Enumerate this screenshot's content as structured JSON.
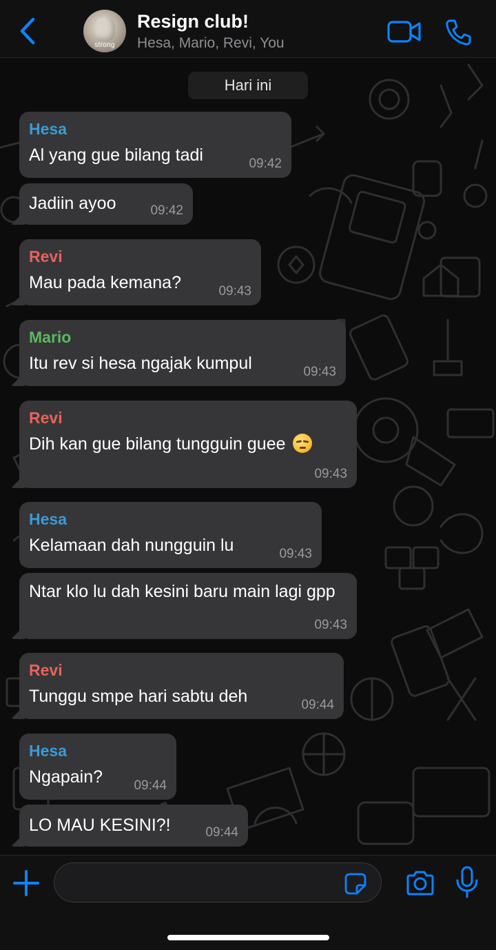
{
  "header": {
    "title": "Resign club!",
    "members": "Hesa, Mario, Revi, You",
    "avatar_caption": "strong"
  },
  "date_chip": "Hari ini",
  "messages": [
    {
      "sender": "Hesa",
      "sender_color": "#3a9bd9",
      "text": "Al yang gue bilang tadi",
      "time": "09:42"
    },
    {
      "sender": "",
      "text": "Jadiin ayoo",
      "time": "09:42"
    },
    {
      "sender": "Revi",
      "sender_color": "#e8635a",
      "text": "Mau pada kemana?",
      "time": "09:43"
    },
    {
      "sender": "Mario",
      "sender_color": "#5cb860",
      "text": "Itu rev si hesa ngajak kumpul",
      "time": "09:43"
    },
    {
      "sender": "Revi",
      "sender_color": "#e8635a",
      "text": "Dih kan gue bilang tungguin guee",
      "emoji": "unamused-face-emoji",
      "time": "09:43"
    },
    {
      "sender": "Hesa",
      "sender_color": "#3a9bd9",
      "text": "Kelamaan dah nungguin lu",
      "time": "09:43"
    },
    {
      "sender": "",
      "text": "Ntar klo lu dah kesini baru main lagi gpp",
      "time": "09:43"
    },
    {
      "sender": "Revi",
      "sender_color": "#e8635a",
      "text": "Tunggu smpe hari sabtu deh",
      "time": "09:44"
    },
    {
      "sender": "Hesa",
      "sender_color": "#3a9bd9",
      "text": "Ngapain?",
      "time": "09:44"
    },
    {
      "sender": "",
      "text": "LO MAU KESINI?!",
      "time": "09:44"
    }
  ],
  "input": {
    "placeholder": ""
  },
  "colors": {
    "accent": "#0a84ff",
    "bubble": "#363638",
    "header_bg": "#111111"
  }
}
